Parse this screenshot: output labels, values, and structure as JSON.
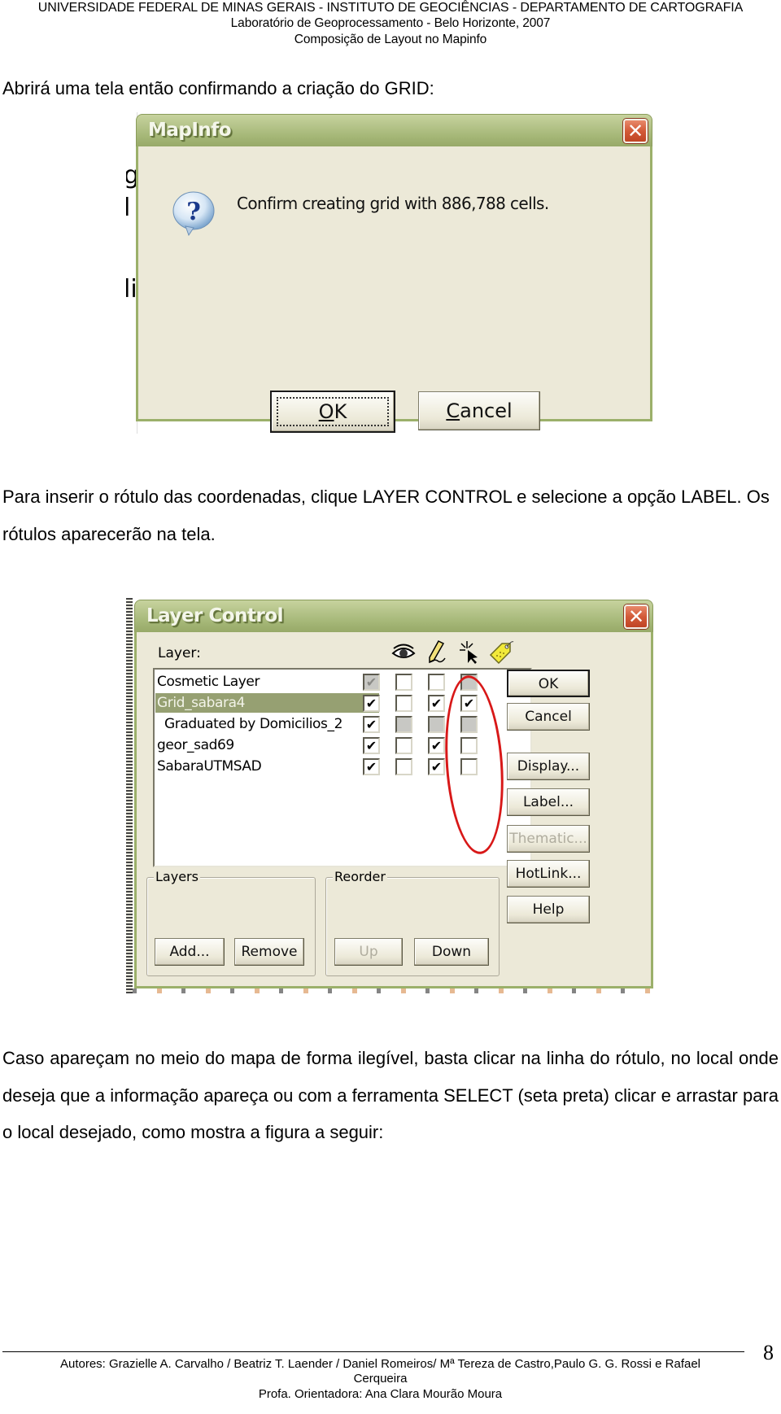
{
  "header": {
    "line1": "UNIVERSIDADE FEDERAL DE MINAS GERAIS - INSTITUTO DE GEOCIÊNCIAS - DEPARTAMENTO DE CARTOGRAFIA",
    "line2": "Laboratório de Geoprocessamento - Belo Horizonte, 2007",
    "line3": "Composição de Layout no Mapinfo"
  },
  "paragraphs": {
    "p1": "Abrirá uma tela então confirmando a criação do GRID:",
    "p2": "Para inserir o rótulo das coordenadas, clique LAYER CONTROL e selecione a opção LABEL. Os rótulos aparecerão na tela.",
    "p3": "Caso apareçam no meio do mapa de forma ilegível, basta clicar na linha do rótulo, no local onde deseja que a informação apareça ou com a ferramenta SELECT (seta preta) clicar e arrastar para o local desejado, como mostra a figura a seguir:"
  },
  "confirm_dialog": {
    "title": "MapInfo",
    "close_glyph": "✕",
    "icon": "question-icon",
    "message": "Confirm creating grid with 886,788 cells.",
    "ok_mnemonic": "O",
    "ok_rest": "K",
    "cancel_mnemonic": "C",
    "cancel_rest": "ancel",
    "background_fragments": [
      "gi",
      "l",
      "li"
    ]
  },
  "layer_control": {
    "title": "Layer Control",
    "close_glyph": "✕",
    "layer_label": "Layer:",
    "column_icons": [
      "visible-eye-icon",
      "editable-pencil-icon",
      "selectable-cursor-icon",
      "autolabel-tag-icon"
    ],
    "check_glyph": "✔",
    "layers": [
      {
        "name": "Cosmetic Layer",
        "selected": false,
        "indent": false,
        "checks": [
          {
            "checked": true,
            "disabled": true
          },
          {
            "checked": false,
            "disabled": false
          },
          {
            "checked": false,
            "disabled": false
          },
          {
            "checked": false,
            "disabled": true
          }
        ]
      },
      {
        "name": "Grid_sabara4",
        "selected": true,
        "indent": false,
        "checks": [
          {
            "checked": true,
            "disabled": false
          },
          {
            "checked": false,
            "disabled": false
          },
          {
            "checked": true,
            "disabled": false
          },
          {
            "checked": true,
            "disabled": false
          }
        ]
      },
      {
        "name": "Graduated by Domicilios_2",
        "selected": false,
        "indent": true,
        "checks": [
          {
            "checked": true,
            "disabled": false
          },
          {
            "checked": false,
            "disabled": true
          },
          {
            "checked": false,
            "disabled": true
          },
          {
            "checked": false,
            "disabled": true
          }
        ]
      },
      {
        "name": "geor_sad69",
        "selected": false,
        "indent": false,
        "checks": [
          {
            "checked": true,
            "disabled": false
          },
          {
            "checked": false,
            "disabled": false
          },
          {
            "checked": true,
            "disabled": false
          },
          {
            "checked": false,
            "disabled": false
          }
        ]
      },
      {
        "name": "SabaraUTMSAD",
        "selected": false,
        "indent": false,
        "checks": [
          {
            "checked": true,
            "disabled": false
          },
          {
            "checked": false,
            "disabled": false
          },
          {
            "checked": true,
            "disabled": false
          },
          {
            "checked": false,
            "disabled": false
          }
        ]
      }
    ],
    "buttons": {
      "ok": "OK",
      "cancel": "Cancel",
      "display": "Display...",
      "label": "Label...",
      "thematic": "Thematic...",
      "hotlink": "HotLink...",
      "help": "Help"
    },
    "layers_group": {
      "label": "Layers",
      "add": "Add...",
      "remove": "Remove"
    },
    "reorder_group": {
      "label": "Reorder",
      "up": "Up",
      "down": "Down"
    },
    "highlight_color": "#d81818"
  },
  "footer": {
    "authors": "Autores: Grazielle A. Carvalho / Beatriz T. Laender / Daniel Romeiros/ Mª Tereza de Castro,Paulo G. G. Rossi  e Rafael",
    "authors_cont": "Cerqueira",
    "advisor": "Profa. Orientadora: Ana Clara Mourão Moura",
    "page_number": "8"
  }
}
